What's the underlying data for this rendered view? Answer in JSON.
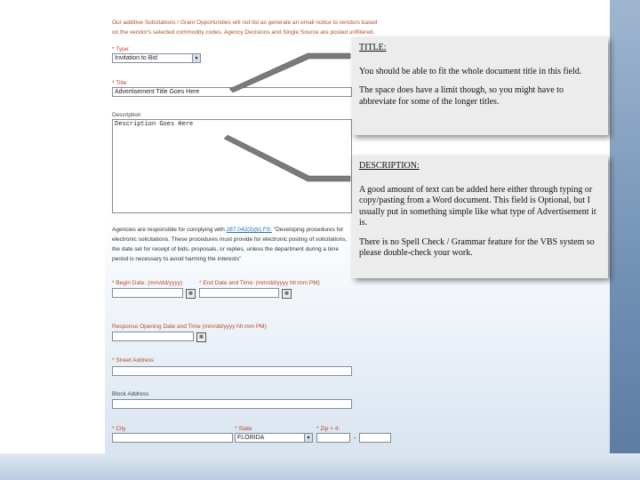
{
  "form": {
    "intro_text": "Our additive Solicitations / Grant Opportunities will not list as generate an email notice to vendors based on the vendor's selected commodity codes. Agency Decisions and Single Source are posted unfiltered.",
    "type_label": "* Type:",
    "type_value": "Invitation to Bid",
    "title_label": "* Title:",
    "title_value": "Advertisement Title Goes Here",
    "description_label": "Description",
    "description_value": "Description Goes Here",
    "agencies_text_1": "Agencies are responsible for complying with",
    "agencies_link": "287.042(3)(b) FS:",
    "agencies_text_2": "\"Developing procedures for electronic solicitations. These procedures must provide for electronic posting of solicitations, the date set for receipt of bids, proposals, or replies, unless the department during a time period is necessary to avoid harming the interests\"",
    "begin_date_label": "* Begin Date: (mm/dd/yyyy)",
    "end_date_label": "* End Date and Time: (mm/dd/yyyy hh:mm PM)",
    "response_label": "Response Opening Date and Time (mm/dd/yyyy hh:mm PM)",
    "street_label": "* Street Address",
    "block_label": "Block Address",
    "city_label": "* City",
    "state_label": "* State",
    "state_value": "FLORIDA",
    "zip_label": "* Zip + 4:",
    "zip_dash": "-"
  },
  "callouts": {
    "title_box": {
      "heading": "TITLE:",
      "p1": "You should be able to fit the whole document title in this field.",
      "p2": "The space does have a limit though, so you might have to abbreviate for some of the longer titles."
    },
    "description_box": {
      "heading": "DESCRIPTION:",
      "p1": "A good amount of text can be added here either through typing or copy/pasting from a Word document. This field is Optional, but I usually put in something simple like what type of Advertisement it is.",
      "p2": "There is no Spell Check / Grammar feature for the VBS system so please double-check your work."
    }
  },
  "icons": {
    "dropdown": "▾",
    "calendar": "▦"
  },
  "colors": {
    "required_label": "#b84a2a",
    "link": "#2d6fb3",
    "callout_bg": "#ececec",
    "accent_blue": "#6f8fb3"
  }
}
